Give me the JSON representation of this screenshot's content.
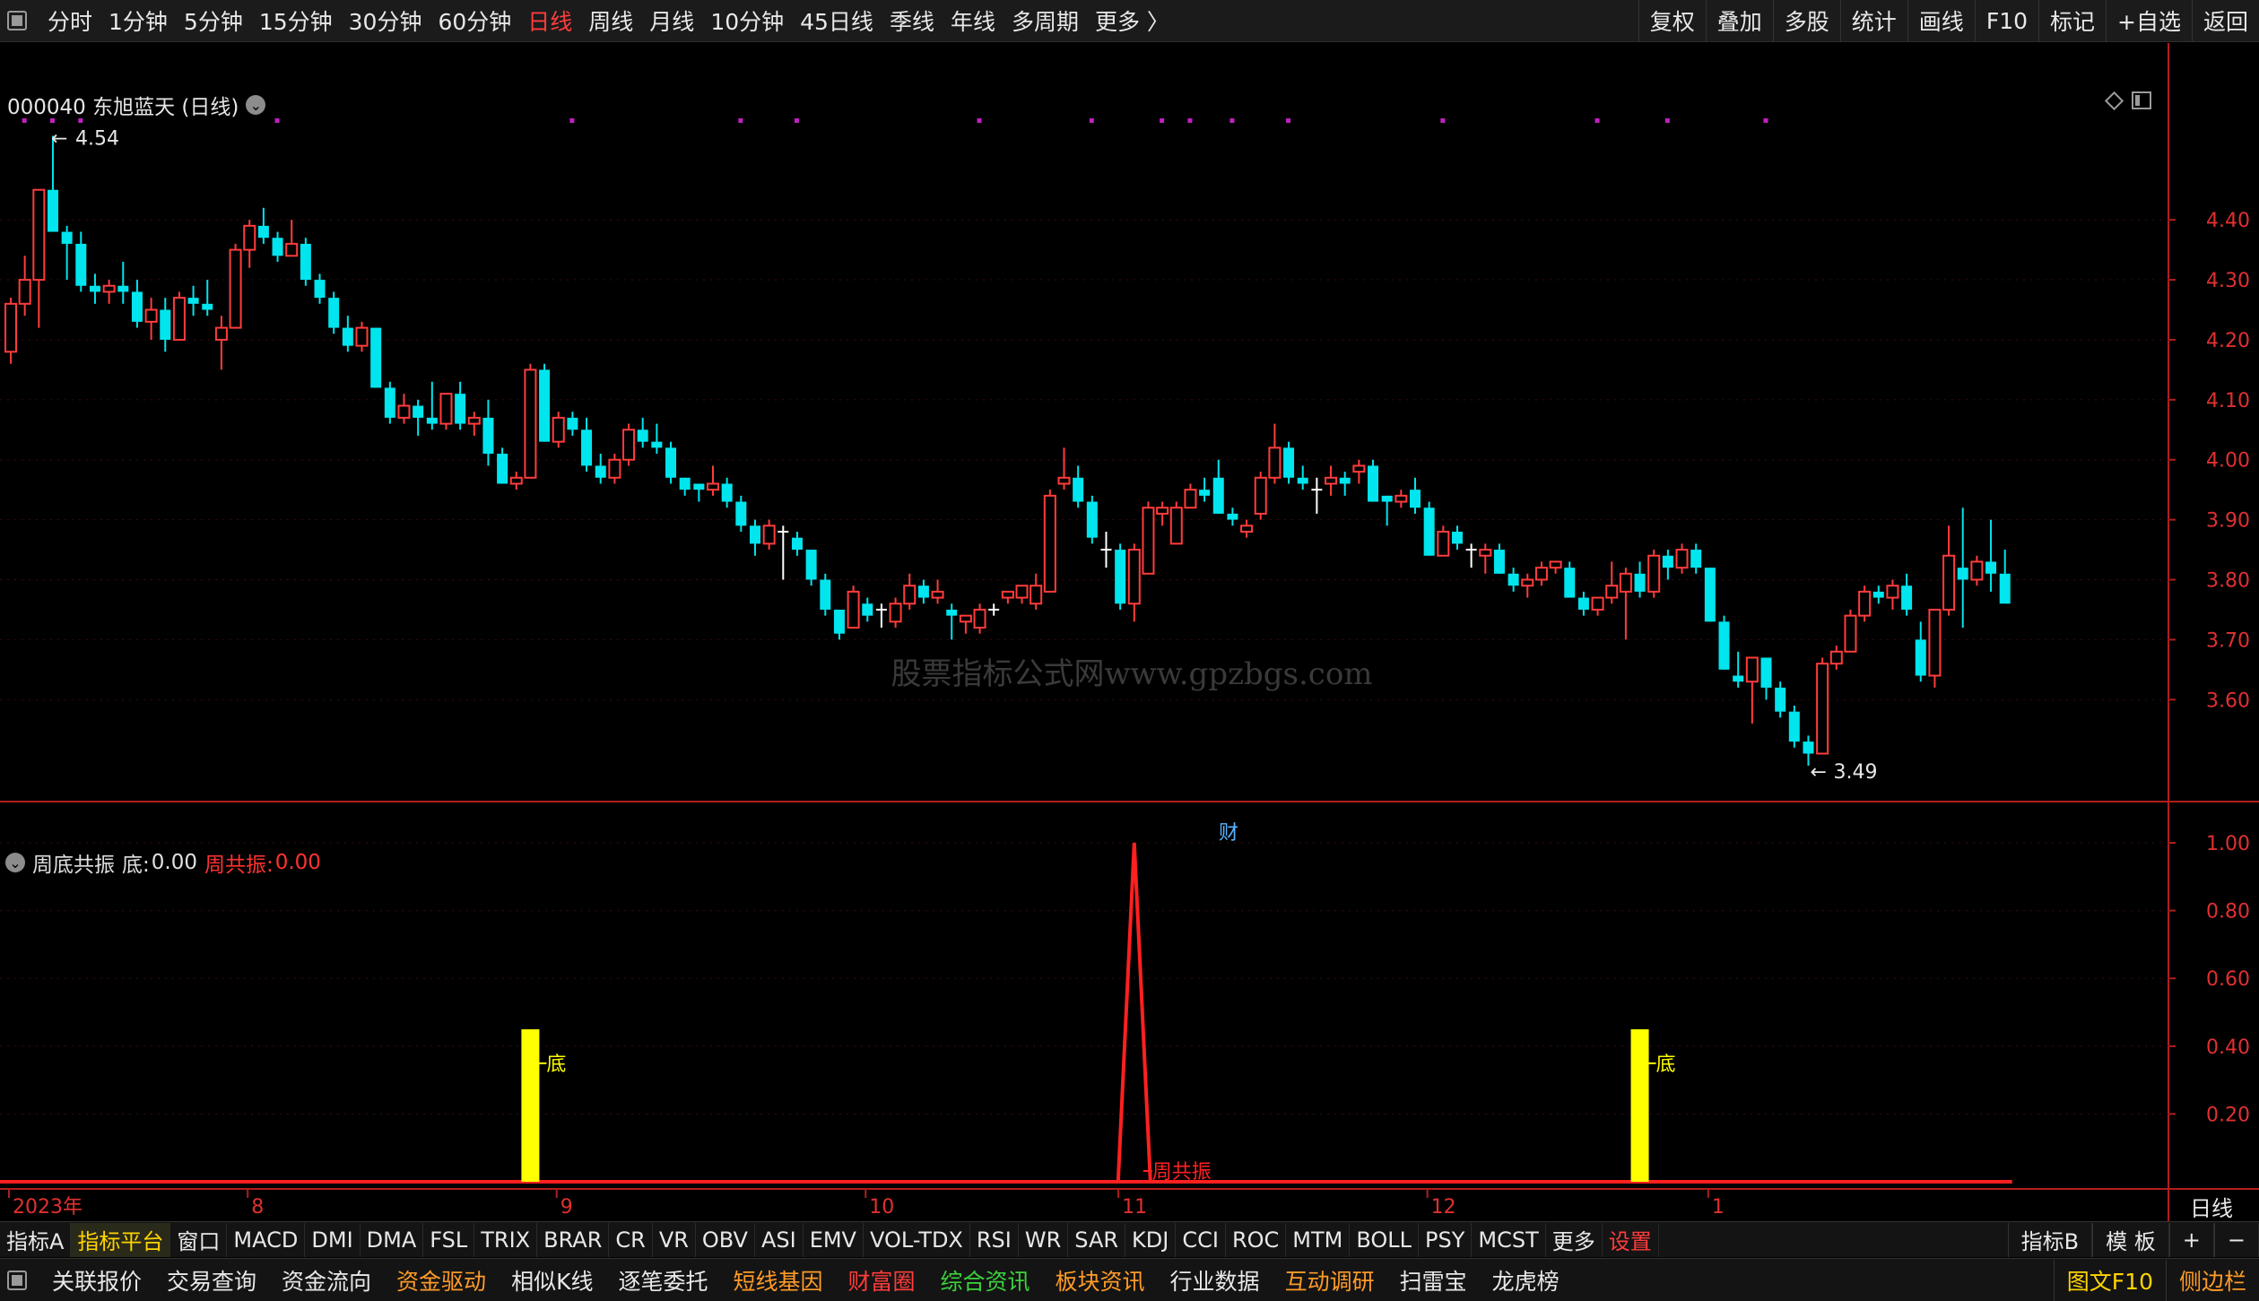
{
  "toolbar": {
    "periods": [
      "分时",
      "1分钟",
      "5分钟",
      "15分钟",
      "30分钟",
      "60分钟",
      "日线",
      "周线",
      "月线",
      "10分钟",
      "45日线",
      "季线",
      "年线",
      "多周期",
      "更多 〉"
    ],
    "active_period": "日线",
    "right_buttons": [
      "复权",
      "叠加",
      "多股",
      "统计",
      "画线",
      "F10",
      "标记",
      "+自选",
      "返回"
    ]
  },
  "main_chart": {
    "title": "000040 东旭蓝天 (日线)",
    "high_label": "4.54",
    "low_label": "3.49",
    "fin_marker": "财",
    "watermark": "股票指标公式网www.gpzbgs.com",
    "price_axis": [
      "4.40",
      "4.30",
      "4.20",
      "4.10",
      "4.00",
      "3.90",
      "3.80",
      "3.70",
      "3.60"
    ]
  },
  "sub_chart": {
    "indicator_name": "周底共振",
    "di_label": "底:",
    "di_value": "0.00",
    "zgz_label": "周共振:",
    "zgz_value": "0.00",
    "bar_label": "底",
    "peak_label": "周共振",
    "value_axis": [
      "1.00",
      "0.80",
      "0.60",
      "0.40",
      "0.20"
    ]
  },
  "time_axis": {
    "labels": [
      "2023年",
      "8",
      "9",
      "10",
      "11",
      "12",
      "1"
    ],
    "period_label": "日线"
  },
  "indicator_tabs": {
    "items": [
      "指标A",
      "指标平台",
      "窗口",
      "MACD",
      "DMI",
      "DMA",
      "FSL",
      "TRIX",
      "BRAR",
      "CR",
      "VR",
      "OBV",
      "ASI",
      "EMV",
      "VOL-TDX",
      "RSI",
      "WR",
      "SAR",
      "KDJ",
      "CCI",
      "ROC",
      "MTM",
      "BOLL",
      "PSY",
      "MCST",
      "更多",
      "设置"
    ],
    "right": [
      "指标B",
      "模 板",
      "+",
      "−"
    ]
  },
  "bottom_bar": {
    "items": [
      "关联报价",
      "交易查询",
      "资金流向",
      "资金驱动",
      "相似K线",
      "逐笔委托",
      "短线基因",
      "财富圈",
      "综合资讯",
      "板块资讯",
      "行业数据",
      "互动调研",
      "扫雷宝",
      "龙虎榜"
    ],
    "right": [
      "图文F10",
      "侧边栏"
    ]
  },
  "colors": {
    "up": "#ff3c3c",
    "down": "#00e5ee",
    "signal_bar": "#ffff00",
    "axis": "#b01e1e",
    "dots": "#c020c0"
  },
  "chart_data": {
    "type": "candlestick",
    "ohlc": [
      [
        4.18,
        4.27,
        4.16,
        4.26
      ],
      [
        4.26,
        4.34,
        4.24,
        4.3
      ],
      [
        4.3,
        4.4,
        4.22,
        4.45
      ],
      [
        4.45,
        4.54,
        4.42,
        4.38
      ],
      [
        4.38,
        4.39,
        4.3,
        4.36
      ],
      [
        4.36,
        4.38,
        4.28,
        4.29
      ],
      [
        4.29,
        4.31,
        4.26,
        4.28
      ],
      [
        4.28,
        4.3,
        4.26,
        4.29
      ],
      [
        4.29,
        4.33,
        4.26,
        4.28
      ],
      [
        4.28,
        4.3,
        4.22,
        4.23
      ],
      [
        4.23,
        4.27,
        4.2,
        4.25
      ],
      [
        4.25,
        4.27,
        4.18,
        4.2
      ],
      [
        4.2,
        4.28,
        4.2,
        4.27
      ],
      [
        4.27,
        4.29,
        4.24,
        4.26
      ],
      [
        4.26,
        4.3,
        4.24,
        4.25
      ],
      [
        4.2,
        4.24,
        4.15,
        4.22
      ],
      [
        4.22,
        4.36,
        4.22,
        4.35
      ],
      [
        4.35,
        4.4,
        4.32,
        4.39
      ],
      [
        4.39,
        4.42,
        4.36,
        4.37
      ],
      [
        4.37,
        4.38,
        4.33,
        4.34
      ],
      [
        4.34,
        4.4,
        4.34,
        4.36
      ],
      [
        4.36,
        4.37,
        4.29,
        4.3
      ],
      [
        4.3,
        4.31,
        4.26,
        4.27
      ],
      [
        4.27,
        4.28,
        4.21,
        4.22
      ],
      [
        4.22,
        4.24,
        4.18,
        4.19
      ],
      [
        4.19,
        4.23,
        4.18,
        4.22
      ],
      [
        4.22,
        4.22,
        4.12,
        4.12
      ],
      [
        4.12,
        4.13,
        4.06,
        4.07
      ],
      [
        4.07,
        4.11,
        4.06,
        4.09
      ],
      [
        4.09,
        4.1,
        4.04,
        4.07
      ],
      [
        4.07,
        4.13,
        4.05,
        4.06
      ],
      [
        4.06,
        4.11,
        4.05,
        4.11
      ],
      [
        4.11,
        4.13,
        4.05,
        4.06
      ],
      [
        4.06,
        4.08,
        4.04,
        4.07
      ],
      [
        4.07,
        4.1,
        3.99,
        4.01
      ],
      [
        4.01,
        4.02,
        3.96,
        3.96
      ],
      [
        3.96,
        3.98,
        3.95,
        3.97
      ],
      [
        3.97,
        4.16,
        3.97,
        4.15
      ],
      [
        4.15,
        4.16,
        4.03,
        4.03
      ],
      [
        4.03,
        4.08,
        4.02,
        4.07
      ],
      [
        4.07,
        4.08,
        4.04,
        4.05
      ],
      [
        4.05,
        4.07,
        3.98,
        3.99
      ],
      [
        3.99,
        4.01,
        3.96,
        3.97
      ],
      [
        3.97,
        4.01,
        3.96,
        4.0
      ],
      [
        4.0,
        4.06,
        3.99,
        4.05
      ],
      [
        4.05,
        4.07,
        4.02,
        4.03
      ],
      [
        4.03,
        4.06,
        4.01,
        4.02
      ],
      [
        4.02,
        4.03,
        3.96,
        3.97
      ],
      [
        3.97,
        3.97,
        3.94,
        3.95
      ],
      [
        3.96,
        3.96,
        3.93,
        3.95
      ],
      [
        3.95,
        3.99,
        3.94,
        3.96
      ],
      [
        3.96,
        3.97,
        3.92,
        3.93
      ],
      [
        3.93,
        3.94,
        3.88,
        3.89
      ],
      [
        3.89,
        3.9,
        3.84,
        3.86
      ],
      [
        3.86,
        3.9,
        3.85,
        3.89
      ],
      [
        3.88,
        3.89,
        3.8,
        3.88
      ],
      [
        3.87,
        3.88,
        3.84,
        3.85
      ],
      [
        3.85,
        3.85,
        3.79,
        3.8
      ],
      [
        3.8,
        3.81,
        3.74,
        3.75
      ],
      [
        3.75,
        3.75,
        3.7,
        3.71
      ],
      [
        3.72,
        3.79,
        3.72,
        3.78
      ],
      [
        3.76,
        3.77,
        3.73,
        3.74
      ],
      [
        3.75,
        3.76,
        3.72,
        3.75
      ],
      [
        3.73,
        3.77,
        3.72,
        3.76
      ],
      [
        3.76,
        3.81,
        3.75,
        3.79
      ],
      [
        3.79,
        3.8,
        3.76,
        3.77
      ],
      [
        3.77,
        3.8,
        3.76,
        3.78
      ],
      [
        3.75,
        3.76,
        3.7,
        3.74
      ],
      [
        3.73,
        3.74,
        3.71,
        3.74
      ],
      [
        3.72,
        3.76,
        3.71,
        3.75
      ],
      [
        3.75,
        3.76,
        3.74,
        3.75
      ],
      [
        3.77,
        3.78,
        3.76,
        3.78
      ],
      [
        3.77,
        3.79,
        3.76,
        3.79
      ],
      [
        3.76,
        3.81,
        3.75,
        3.79
      ],
      [
        3.78,
        3.95,
        3.78,
        3.94
      ],
      [
        3.96,
        4.02,
        3.95,
        3.97
      ],
      [
        3.97,
        3.99,
        3.92,
        3.93
      ],
      [
        3.93,
        3.94,
        3.86,
        3.87
      ],
      [
        3.85,
        3.88,
        3.82,
        3.85
      ],
      [
        3.85,
        3.86,
        3.75,
        3.76
      ],
      [
        3.76,
        3.86,
        3.73,
        3.85
      ],
      [
        3.81,
        3.93,
        3.81,
        3.92
      ],
      [
        3.91,
        3.93,
        3.89,
        3.92
      ],
      [
        3.86,
        3.93,
        3.86,
        3.92
      ],
      [
        3.92,
        3.96,
        3.92,
        3.95
      ],
      [
        3.95,
        3.97,
        3.93,
        3.94
      ],
      [
        3.97,
        4.0,
        3.91,
        3.91
      ],
      [
        3.91,
        3.92,
        3.89,
        3.9
      ],
      [
        3.88,
        3.9,
        3.87,
        3.89
      ],
      [
        3.91,
        3.98,
        3.9,
        3.97
      ],
      [
        3.97,
        4.06,
        3.96,
        4.02
      ],
      [
        4.02,
        4.03,
        3.96,
        3.97
      ],
      [
        3.97,
        3.99,
        3.95,
        3.96
      ],
      [
        3.95,
        3.97,
        3.91,
        3.95
      ],
      [
        3.96,
        3.99,
        3.94,
        3.97
      ],
      [
        3.97,
        3.98,
        3.94,
        3.96
      ],
      [
        3.98,
        4.0,
        3.96,
        3.99
      ],
      [
        3.99,
        4.0,
        3.93,
        3.93
      ],
      [
        3.94,
        3.94,
        3.89,
        3.93
      ],
      [
        3.93,
        3.95,
        3.92,
        3.94
      ],
      [
        3.95,
        3.97,
        3.91,
        3.92
      ],
      [
        3.92,
        3.93,
        3.84,
        3.84
      ],
      [
        3.84,
        3.89,
        3.84,
        3.88
      ],
      [
        3.88,
        3.89,
        3.85,
        3.86
      ],
      [
        3.85,
        3.86,
        3.82,
        3.85
      ],
      [
        3.84,
        3.86,
        3.81,
        3.85
      ],
      [
        3.85,
        3.86,
        3.81,
        3.81
      ],
      [
        3.81,
        3.82,
        3.78,
        3.79
      ],
      [
        3.79,
        3.81,
        3.77,
        3.8
      ],
      [
        3.8,
        3.83,
        3.79,
        3.82
      ],
      [
        3.82,
        3.83,
        3.81,
        3.83
      ],
      [
        3.82,
        3.83,
        3.77,
        3.77
      ],
      [
        3.77,
        3.78,
        3.74,
        3.75
      ],
      [
        3.75,
        3.77,
        3.74,
        3.77
      ],
      [
        3.77,
        3.83,
        3.76,
        3.79
      ],
      [
        3.78,
        3.82,
        3.7,
        3.81
      ],
      [
        3.81,
        3.83,
        3.77,
        3.78
      ],
      [
        3.78,
        3.85,
        3.77,
        3.84
      ],
      [
        3.84,
        3.85,
        3.8,
        3.82
      ],
      [
        3.82,
        3.86,
        3.81,
        3.85
      ],
      [
        3.85,
        3.86,
        3.81,
        3.82
      ],
      [
        3.82,
        3.82,
        3.73,
        3.73
      ],
      [
        3.73,
        3.74,
        3.65,
        3.65
      ],
      [
        3.64,
        3.68,
        3.62,
        3.63
      ],
      [
        3.63,
        3.67,
        3.56,
        3.67
      ],
      [
        3.67,
        3.67,
        3.6,
        3.62
      ],
      [
        3.62,
        3.63,
        3.57,
        3.58
      ],
      [
        3.58,
        3.59,
        3.52,
        3.53
      ],
      [
        3.53,
        3.54,
        3.49,
        3.51
      ],
      [
        3.51,
        3.67,
        3.51,
        3.66
      ],
      [
        3.66,
        3.69,
        3.65,
        3.68
      ],
      [
        3.68,
        3.75,
        3.68,
        3.74
      ],
      [
        3.74,
        3.79,
        3.73,
        3.78
      ],
      [
        3.78,
        3.79,
        3.76,
        3.77
      ],
      [
        3.77,
        3.8,
        3.75,
        3.79
      ],
      [
        3.79,
        3.81,
        3.74,
        3.75
      ],
      [
        3.7,
        3.73,
        3.63,
        3.64
      ],
      [
        3.64,
        3.75,
        3.62,
        3.75
      ],
      [
        3.75,
        3.89,
        3.74,
        3.84
      ],
      [
        3.82,
        3.92,
        3.72,
        3.8
      ],
      [
        3.8,
        3.84,
        3.79,
        3.83
      ],
      [
        3.83,
        3.9,
        3.78,
        3.81
      ],
      [
        3.81,
        3.85,
        3.77,
        3.76
      ]
    ],
    "price_ticks": [
      4.4,
      4.3,
      4.2,
      4.1,
      4.0,
      3.9,
      3.8,
      3.7,
      3.6
    ],
    "y_range": [
      3.43,
      4.62
    ],
    "week_signal_indices": [
      37,
      80,
      116
    ],
    "peak_index": 80,
    "signal_height": 0.45,
    "peak_value": 1.0,
    "sub_ticks": [
      1.0,
      0.8,
      0.6,
      0.4,
      0.2
    ],
    "month_label_indices": [
      0,
      17,
      39,
      61,
      79,
      101,
      121
    ],
    "dot_indices": [
      1,
      3,
      5,
      19,
      40,
      52,
      56,
      69,
      77,
      82,
      84,
      87,
      91,
      102,
      113,
      118,
      125
    ]
  }
}
